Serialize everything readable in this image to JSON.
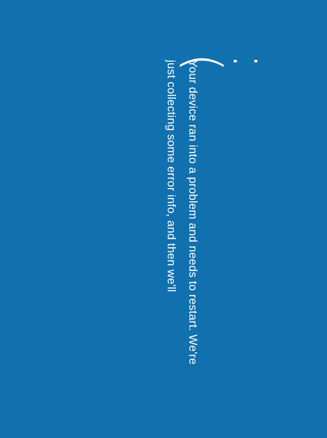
{
  "screen": {
    "background_color": "#1170ae",
    "text_color": "#ffffff"
  },
  "frown": {
    "glyph": ":("
  },
  "message": {
    "line1": "Your device ran into a problem and needs to restart. We're",
    "line2": "just collecting some error info, and then we'll"
  }
}
